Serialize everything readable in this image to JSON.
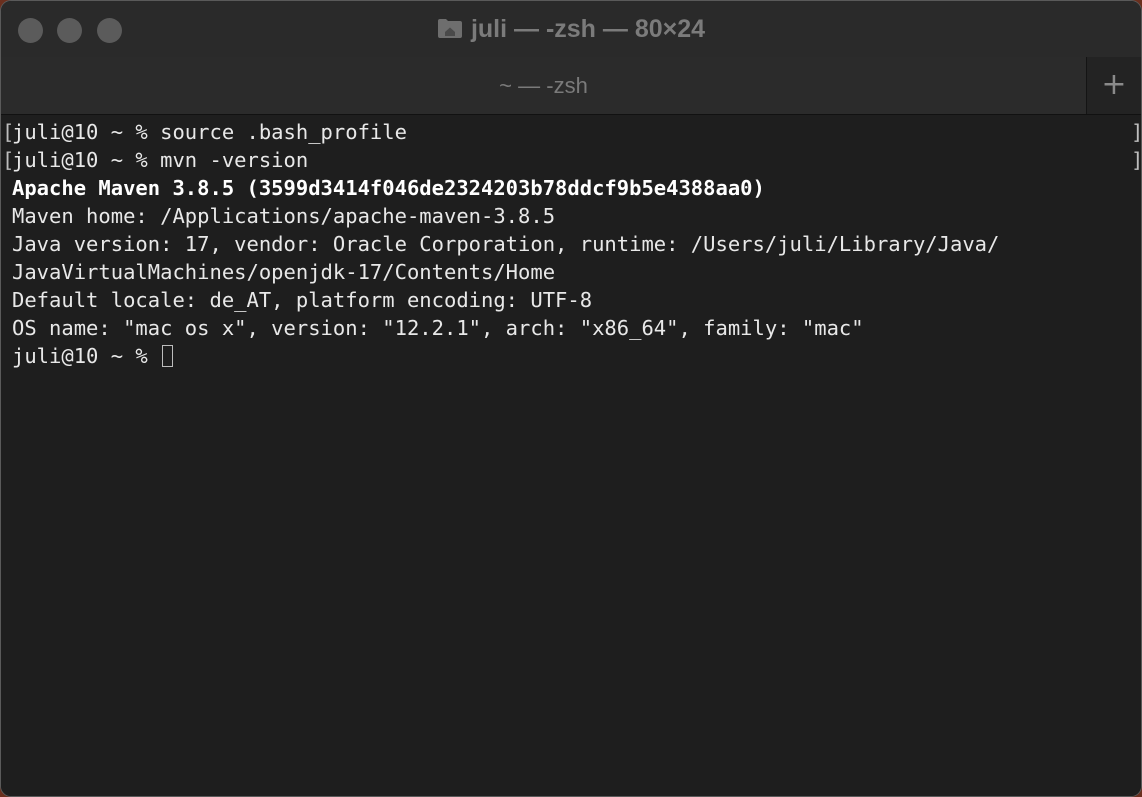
{
  "window": {
    "title": "juli — -zsh — 80×24",
    "title_icon": "home-folder-icon"
  },
  "tabs": [
    {
      "label": "~ — -zsh",
      "active": true
    }
  ],
  "new_tab_label": "+",
  "terminal": {
    "lines": [
      {
        "text": "juli@10 ~ % source .bash_profile",
        "bold": false
      },
      {
        "text": "juli@10 ~ % mvn -version",
        "bold": false
      },
      {
        "text": "Apache Maven 3.8.5 (3599d3414f046de2324203b78ddcf9b5e4388aa0)",
        "bold": true
      },
      {
        "text": "Maven home: /Applications/apache-maven-3.8.5",
        "bold": false
      },
      {
        "text": "Java version: 17, vendor: Oracle Corporation, runtime: /Users/juli/Library/Java/",
        "bold": false
      },
      {
        "text": "JavaVirtualMachines/openjdk-17/Contents/Home",
        "bold": false
      },
      {
        "text": "Default locale: de_AT, platform encoding: UTF-8",
        "bold": false
      },
      {
        "text": "OS name: \"mac os x\", version: \"12.2.1\", arch: \"x86_64\", family: \"mac\"",
        "bold": false
      }
    ],
    "prompt": "juli@10 ~ % ",
    "mark_open": "[",
    "mark_close": "]"
  },
  "colors": {
    "background": "#1e1e1e",
    "text": "#e8e8e8",
    "title_text": "#7b7b7b"
  }
}
